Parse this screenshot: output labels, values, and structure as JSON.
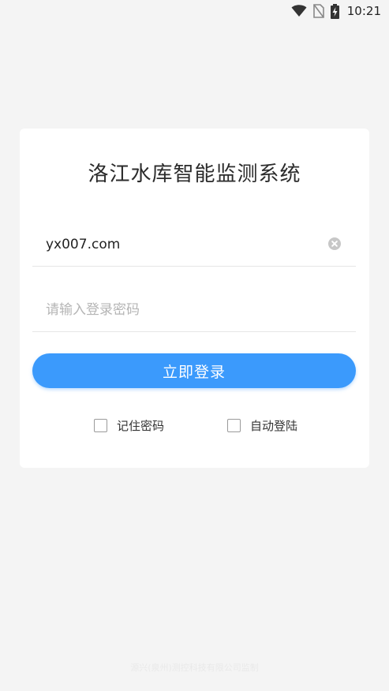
{
  "status_bar": {
    "time": "10:21",
    "icons": [
      "wifi-icon",
      "no-sim-icon",
      "battery-charging-icon"
    ]
  },
  "login": {
    "title": "洛江水库智能监测系统",
    "account": {
      "value": "yx007.com",
      "placeholder": ""
    },
    "password": {
      "value": "",
      "placeholder": "请输入登录密码"
    },
    "submit_label": "立即登录",
    "remember_label": "记住密码",
    "remember_checked": false,
    "auto_login_label": "自动登陆",
    "auto_login_checked": false
  },
  "footer": {
    "text": "源兴(泉州)测控科技有限公司监制"
  },
  "colors": {
    "background": "#f4f4f4",
    "card": "#ffffff",
    "accent": "#3b9afc"
  }
}
